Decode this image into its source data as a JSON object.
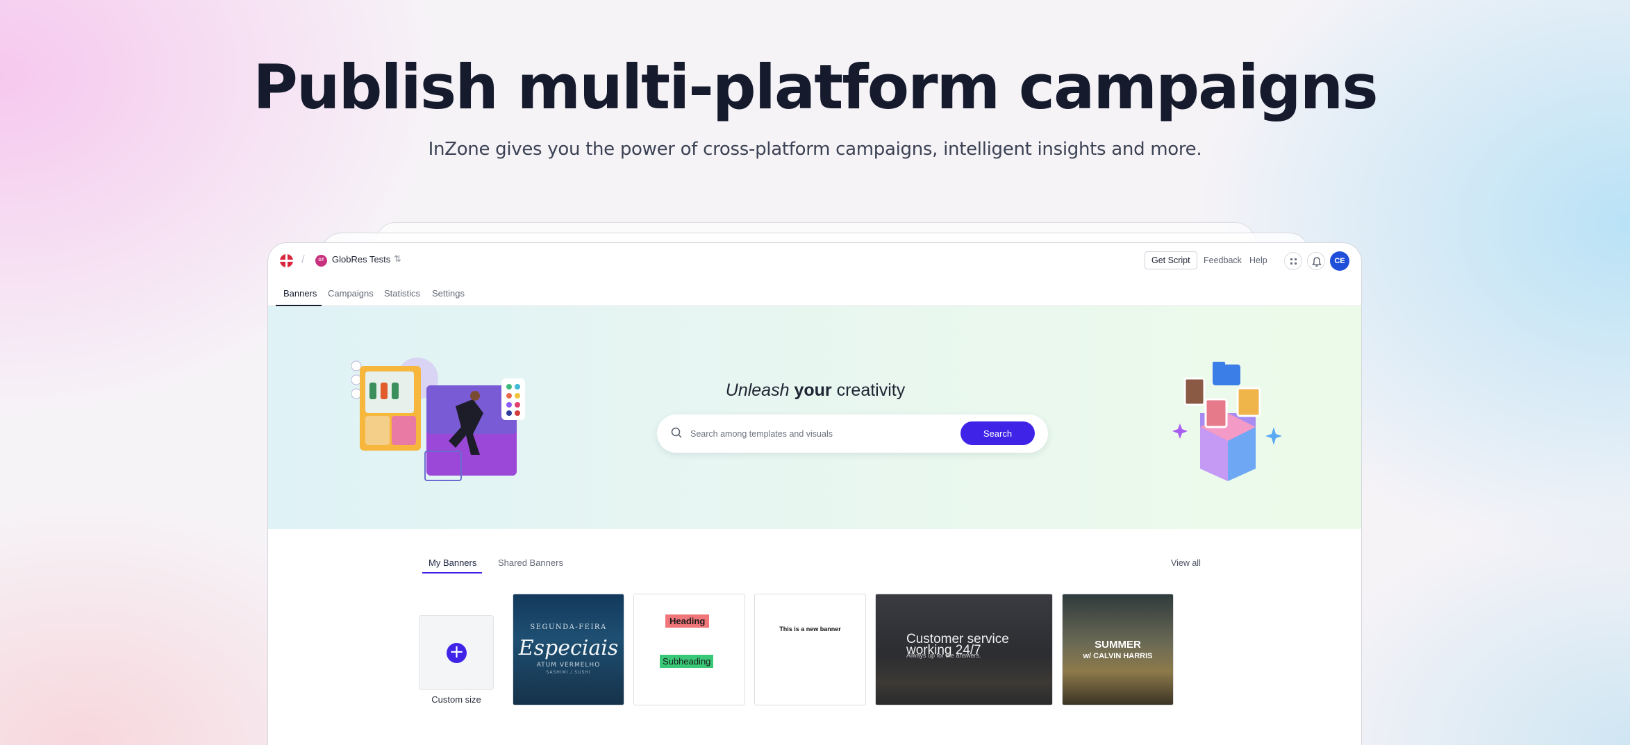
{
  "hero": {
    "title": "Publish multi-platform campaigns",
    "subtitle": "InZone gives you the power of cross-platform campaigns, intelligent insights and more."
  },
  "topbar": {
    "workspace_initials": "GT",
    "workspace_name": "GlobRes Tests",
    "get_script_label": "Get Script",
    "feedback_label": "Feedback",
    "help_label": "Help",
    "user_initials": "CE"
  },
  "nav_tabs": [
    {
      "label": "Banners",
      "active": true
    },
    {
      "label": "Campaigns",
      "active": false
    },
    {
      "label": "Statistics",
      "active": false
    },
    {
      "label": "Settings",
      "active": false
    }
  ],
  "banner": {
    "headline_italic": "Unleash",
    "headline_bold": "your",
    "headline_rest": "creativity",
    "search_placeholder": "Search among templates and visuals",
    "search_button": "Search"
  },
  "section_tabs": [
    {
      "label": "My Banners",
      "active": true
    },
    {
      "label": "Shared Banners",
      "active": false
    }
  ],
  "view_all_label": "View all",
  "custom_size_label": "Custom size",
  "cards": {
    "card1": {
      "line1": "SEGUNDA-FEIRA",
      "line2": "Especiais",
      "line3": "ATUM VERMELHO",
      "line4": "SASHIMI / SUSHI"
    },
    "card2": {
      "heading": "Heading",
      "subheading": "Subheading"
    },
    "card3": {
      "text": "This is a new banner"
    },
    "card4": {
      "line1": "Customer service",
      "line2": "working 24/7",
      "line3": "Always up for the answers."
    },
    "card5": {
      "line1": "SUMMER",
      "line2": "w/ CALVIN HARRIS"
    }
  },
  "colors": {
    "accent": "#3f24e8",
    "logo_red": "#d7263d",
    "avatar_blue": "#1f4fd8"
  }
}
